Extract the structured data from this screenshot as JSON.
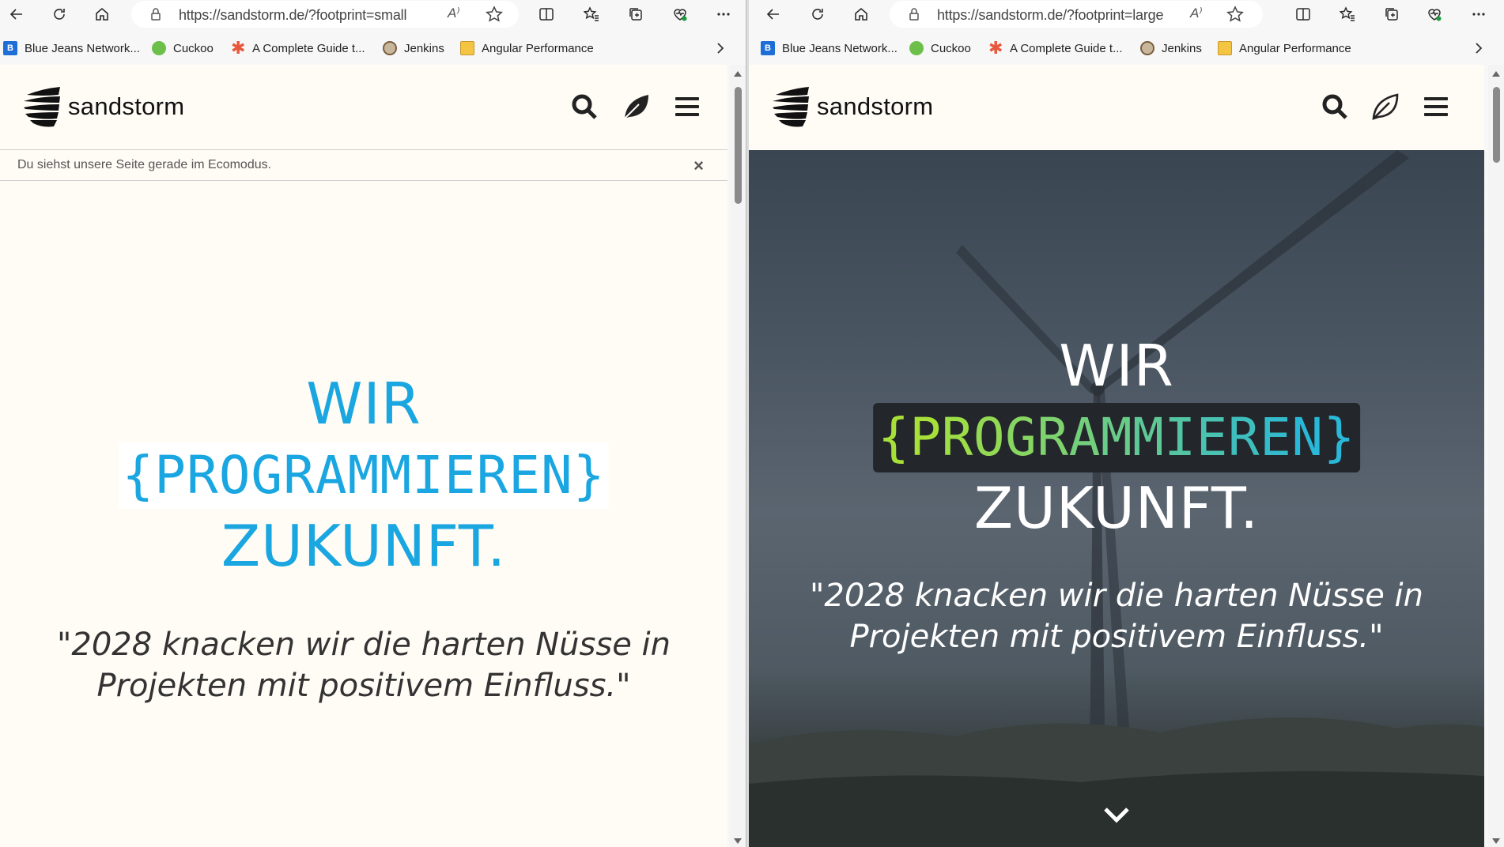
{
  "left": {
    "url": "https://sandstorm.de/?footprint=small",
    "read_aloud": "A⁾",
    "bookmarks": [
      "Blue Jeans Network...",
      "Cuckoo",
      "A Complete Guide t...",
      "Jenkins",
      "Angular Performance"
    ],
    "bookmark_icons": [
      "bluejeans-icon",
      "cuckoo-icon",
      "asterisk-icon",
      "jenkins-icon",
      "folder-icon"
    ],
    "logo": "sandstorm",
    "eco_banner": "Du siehst unsere Seite gerade im Ecomodus.",
    "eco_close": "×",
    "hero": {
      "line1": "WIR",
      "line2": "{PROGRAMMIEREN}",
      "line3": "ZUKUNFT.",
      "quote": "\"2028 knacken wir die harten Nüsse in Projekten mit positivem Einfluss.\""
    },
    "accent_color": "#1aa6e0"
  },
  "right": {
    "url": "https://sandstorm.de/?footprint=large",
    "read_aloud": "A⁾",
    "bookmarks": [
      "Blue Jeans Network...",
      "Cuckoo",
      "A Complete Guide t...",
      "Jenkins",
      "Angular Performance"
    ],
    "bookmark_icons": [
      "bluejeans-icon",
      "cuckoo-icon",
      "asterisk-icon",
      "jenkins-icon",
      "folder-icon"
    ],
    "logo": "sandstorm",
    "hero": {
      "line1": "WIR",
      "line2_open": "{",
      "line2_word": "PROGRAMMIEREN",
      "line2_close": "}",
      "line3": "ZUKUNFT.",
      "quote": "\"2028 knacken wir die harten Nüsse in Projekten mit positivem Einfluss.\""
    },
    "gradient_colors": [
      "#a8e03a",
      "#29b8d8"
    ]
  }
}
